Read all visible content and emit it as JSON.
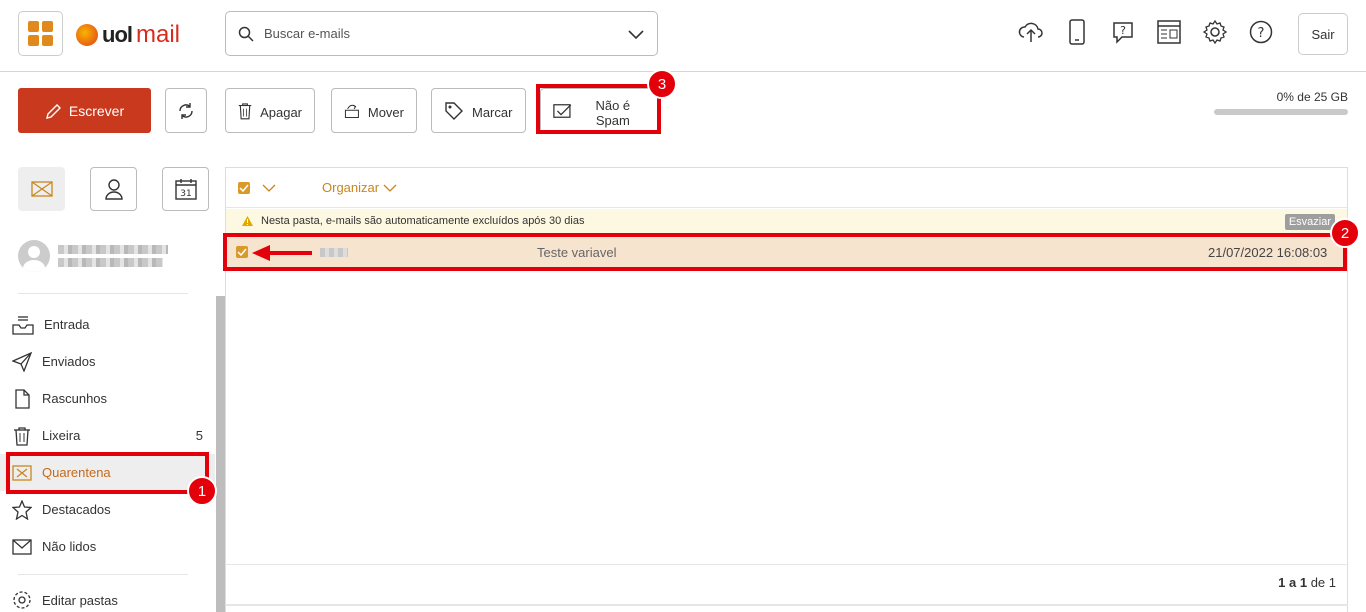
{
  "header": {
    "logo_uol": "uol",
    "logo_mail": "mail",
    "search_placeholder": "Buscar e-mails",
    "top_icons": [
      "cloud-upload-icon",
      "mobile-icon",
      "help-question-icon",
      "layout-icon",
      "gear-icon",
      "help-circle-icon"
    ],
    "logout_label": "Sair"
  },
  "toolbar": {
    "compose_label": "Escrever",
    "delete_label": "Apagar",
    "move_label": "Mover",
    "tag_label": "Marcar",
    "not_spam_label": "Não é Spam"
  },
  "quota": {
    "text": "0% de 25 GB",
    "used_percent": 0
  },
  "sidebar": {
    "folders": [
      {
        "label": "Entrada",
        "icon": "inbox-icon",
        "count": ""
      },
      {
        "label": "Enviados",
        "icon": "send-icon",
        "count": ""
      },
      {
        "label": "Rascunhos",
        "icon": "draft-icon",
        "count": ""
      },
      {
        "label": "Lixeira",
        "icon": "trash-icon",
        "count": "5"
      },
      {
        "label": "Quarentena",
        "icon": "quarantine-icon",
        "count": ""
      },
      {
        "label": "Destacados",
        "icon": "star-icon",
        "count": ""
      },
      {
        "label": "Não lidos",
        "icon": "envelope-icon",
        "count": ""
      }
    ],
    "edit_folders_label": "Editar pastas"
  },
  "list": {
    "organize_label": "Organizar",
    "notice": "Nesta pasta, e-mails são automaticamente excluídos após 30 dias",
    "empty_label": "Esvaziar",
    "messages": [
      {
        "subject": "Teste variavel",
        "date": "21/07/2022 16:08:03"
      }
    ],
    "pager_bold": "1 a 1",
    "pager_rest": " de 1"
  },
  "annotations": {
    "badge1": "1",
    "badge2": "2",
    "badge3": "3",
    "highlight_color": "#e4000a"
  },
  "colors": {
    "accent": "#c8391d",
    "orange": "#e08a1e",
    "selected_row": "#f6e4cf"
  }
}
